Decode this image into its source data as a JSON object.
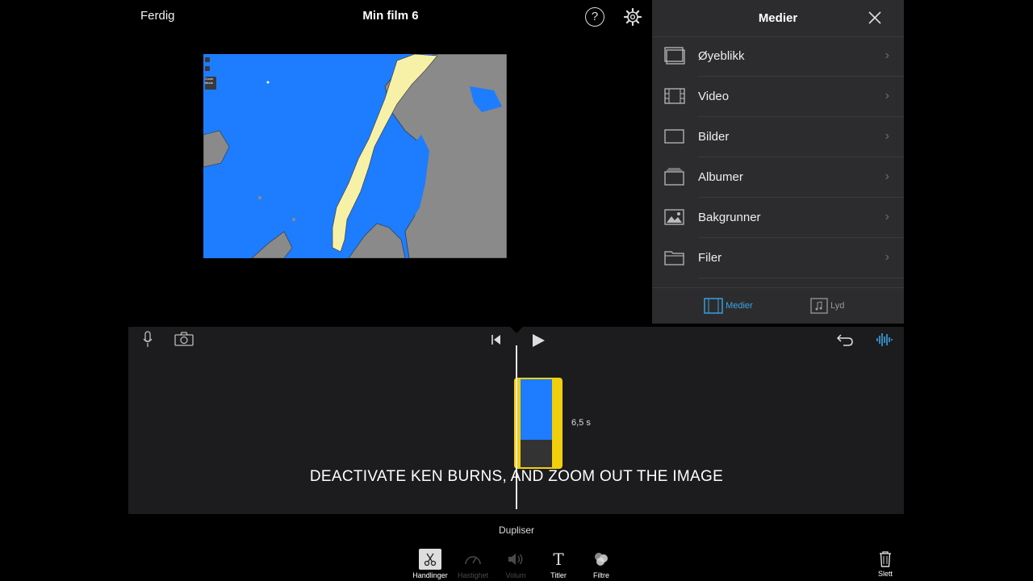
{
  "topbar": {
    "done": "Ferdig",
    "title": "Min film 6"
  },
  "panel": {
    "title": "Medier",
    "items": [
      {
        "label": "Øyeblikk",
        "icon": "moments-icon"
      },
      {
        "label": "Video",
        "icon": "film-icon"
      },
      {
        "label": "Bilder",
        "icon": "photo-frame-icon"
      },
      {
        "label": "Albumer",
        "icon": "album-icon"
      },
      {
        "label": "Bakgrunner",
        "icon": "background-image-icon"
      },
      {
        "label": "Filer",
        "icon": "folder-icon"
      }
    ],
    "tabs": [
      {
        "label": "Medier",
        "active": true
      },
      {
        "label": "Lyd",
        "active": false
      }
    ]
  },
  "preview": {
    "mini_controls": [
      "Zoom Mode"
    ]
  },
  "timeline": {
    "clip_duration": "6,5 s"
  },
  "caption": "DEACTIVATE KEN BURNS, AND ZOOM OUT THE IMAGE",
  "actions": {
    "selected_action": "Dupliser",
    "tools": [
      {
        "label": "Handlinger",
        "icon": "scissors-icon",
        "enabled": true,
        "selected": true
      },
      {
        "label": "Hastighet",
        "icon": "speed-icon",
        "enabled": false
      },
      {
        "label": "Volum",
        "icon": "volume-icon",
        "enabled": false
      },
      {
        "label": "Titler",
        "icon": "titles-icon",
        "enabled": true
      },
      {
        "label": "Filtre",
        "icon": "filters-icon",
        "enabled": true
      }
    ],
    "delete": "Slett"
  },
  "colors": {
    "accent": "#3aa4e8",
    "clip_border": "#f2cf0d",
    "map_sea": "#1e7cff",
    "map_norway": "#f7f1a8",
    "map_land": "#8a8a8a"
  }
}
